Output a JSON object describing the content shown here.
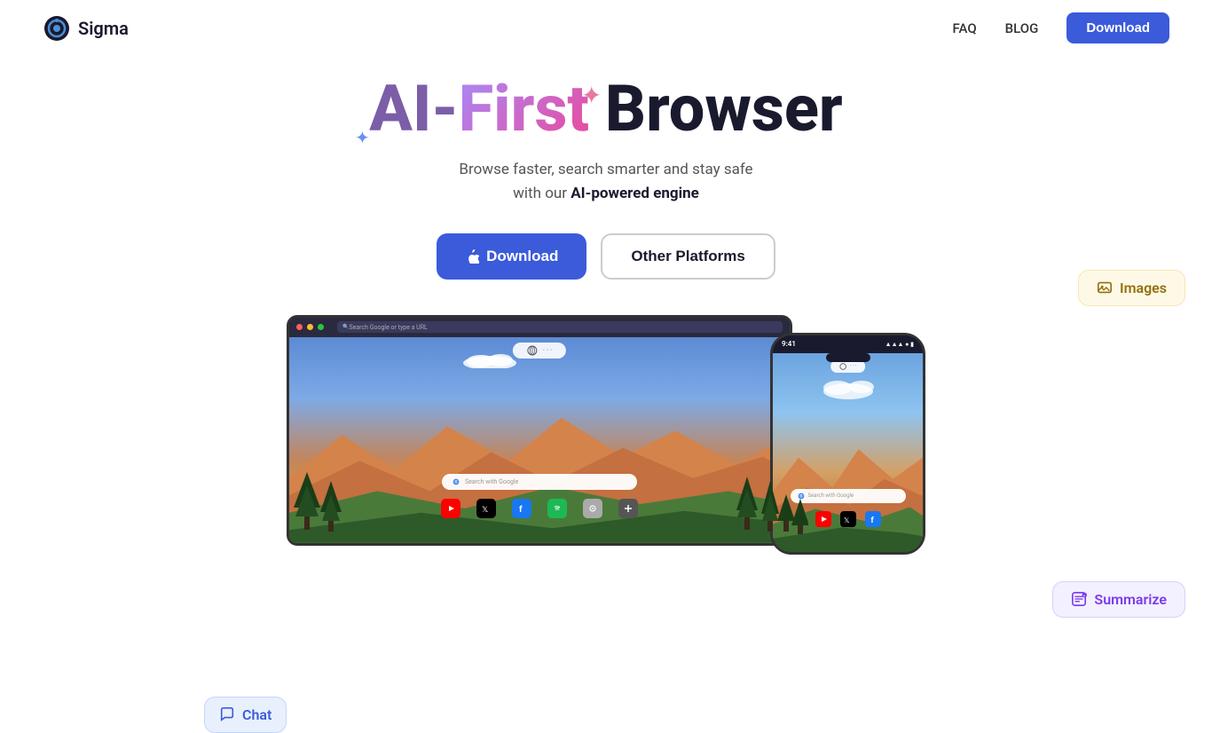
{
  "nav": {
    "logo_text": "Sigma",
    "faq_label": "FAQ",
    "blog_label": "BLOG",
    "download_label": "Download"
  },
  "hero": {
    "title_part1": "AI-First",
    "title_part2": " Browser",
    "subtitle_line1": "Browse faster, search smarter and stay safe",
    "subtitle_line2": "with our ",
    "subtitle_bold": "AI-powered engine",
    "btn_download": "Download",
    "btn_other_platforms": "Other Platforms"
  },
  "badges": {
    "chat": "Chat",
    "summarize": "Summarize",
    "images": "Images"
  },
  "tablet": {
    "address_placeholder": "Search Google or type a URL",
    "search_placeholder": "Search with Google"
  },
  "phone": {
    "time": "9:41",
    "search_placeholder": "Search with Google"
  },
  "colors": {
    "primary_blue": "#3b5bdb",
    "purple": "#7c3aed",
    "pink": "#e879a0",
    "logo_bg": "#1a1a2e"
  }
}
